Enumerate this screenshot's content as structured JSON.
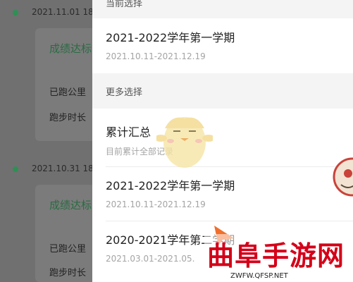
{
  "background": {
    "records": [
      {
        "date": "2021.11.01 18",
        "title": "成绩达标",
        "lines": [
          "已跑公里",
          "跑步时长"
        ]
      },
      {
        "date": "2021.10.31 18",
        "title": "成绩达标",
        "lines": [
          "已跑公里",
          "跑步时长"
        ]
      }
    ]
  },
  "drawer": {
    "current_label": "当前选择",
    "current": {
      "title": "2021-2022学年第一学期",
      "range": "2021.10.11-2021.12.19"
    },
    "more_label": "更多选择",
    "options": [
      {
        "title": "累计汇总",
        "range": "目前累计全部记录"
      },
      {
        "title": "2021-2022学年第一学期",
        "range": "2021.10.11-2021.12.19"
      },
      {
        "title": "2020-2021学年第二学期",
        "range": "2021.03.01-2021.05."
      }
    ]
  },
  "watermark": {
    "text": "曲阜手游网",
    "url": "ZWFW.QFSP.NET"
  },
  "colors": {
    "accent_green": "#2f8f55",
    "watermark_red": "#d40019"
  }
}
